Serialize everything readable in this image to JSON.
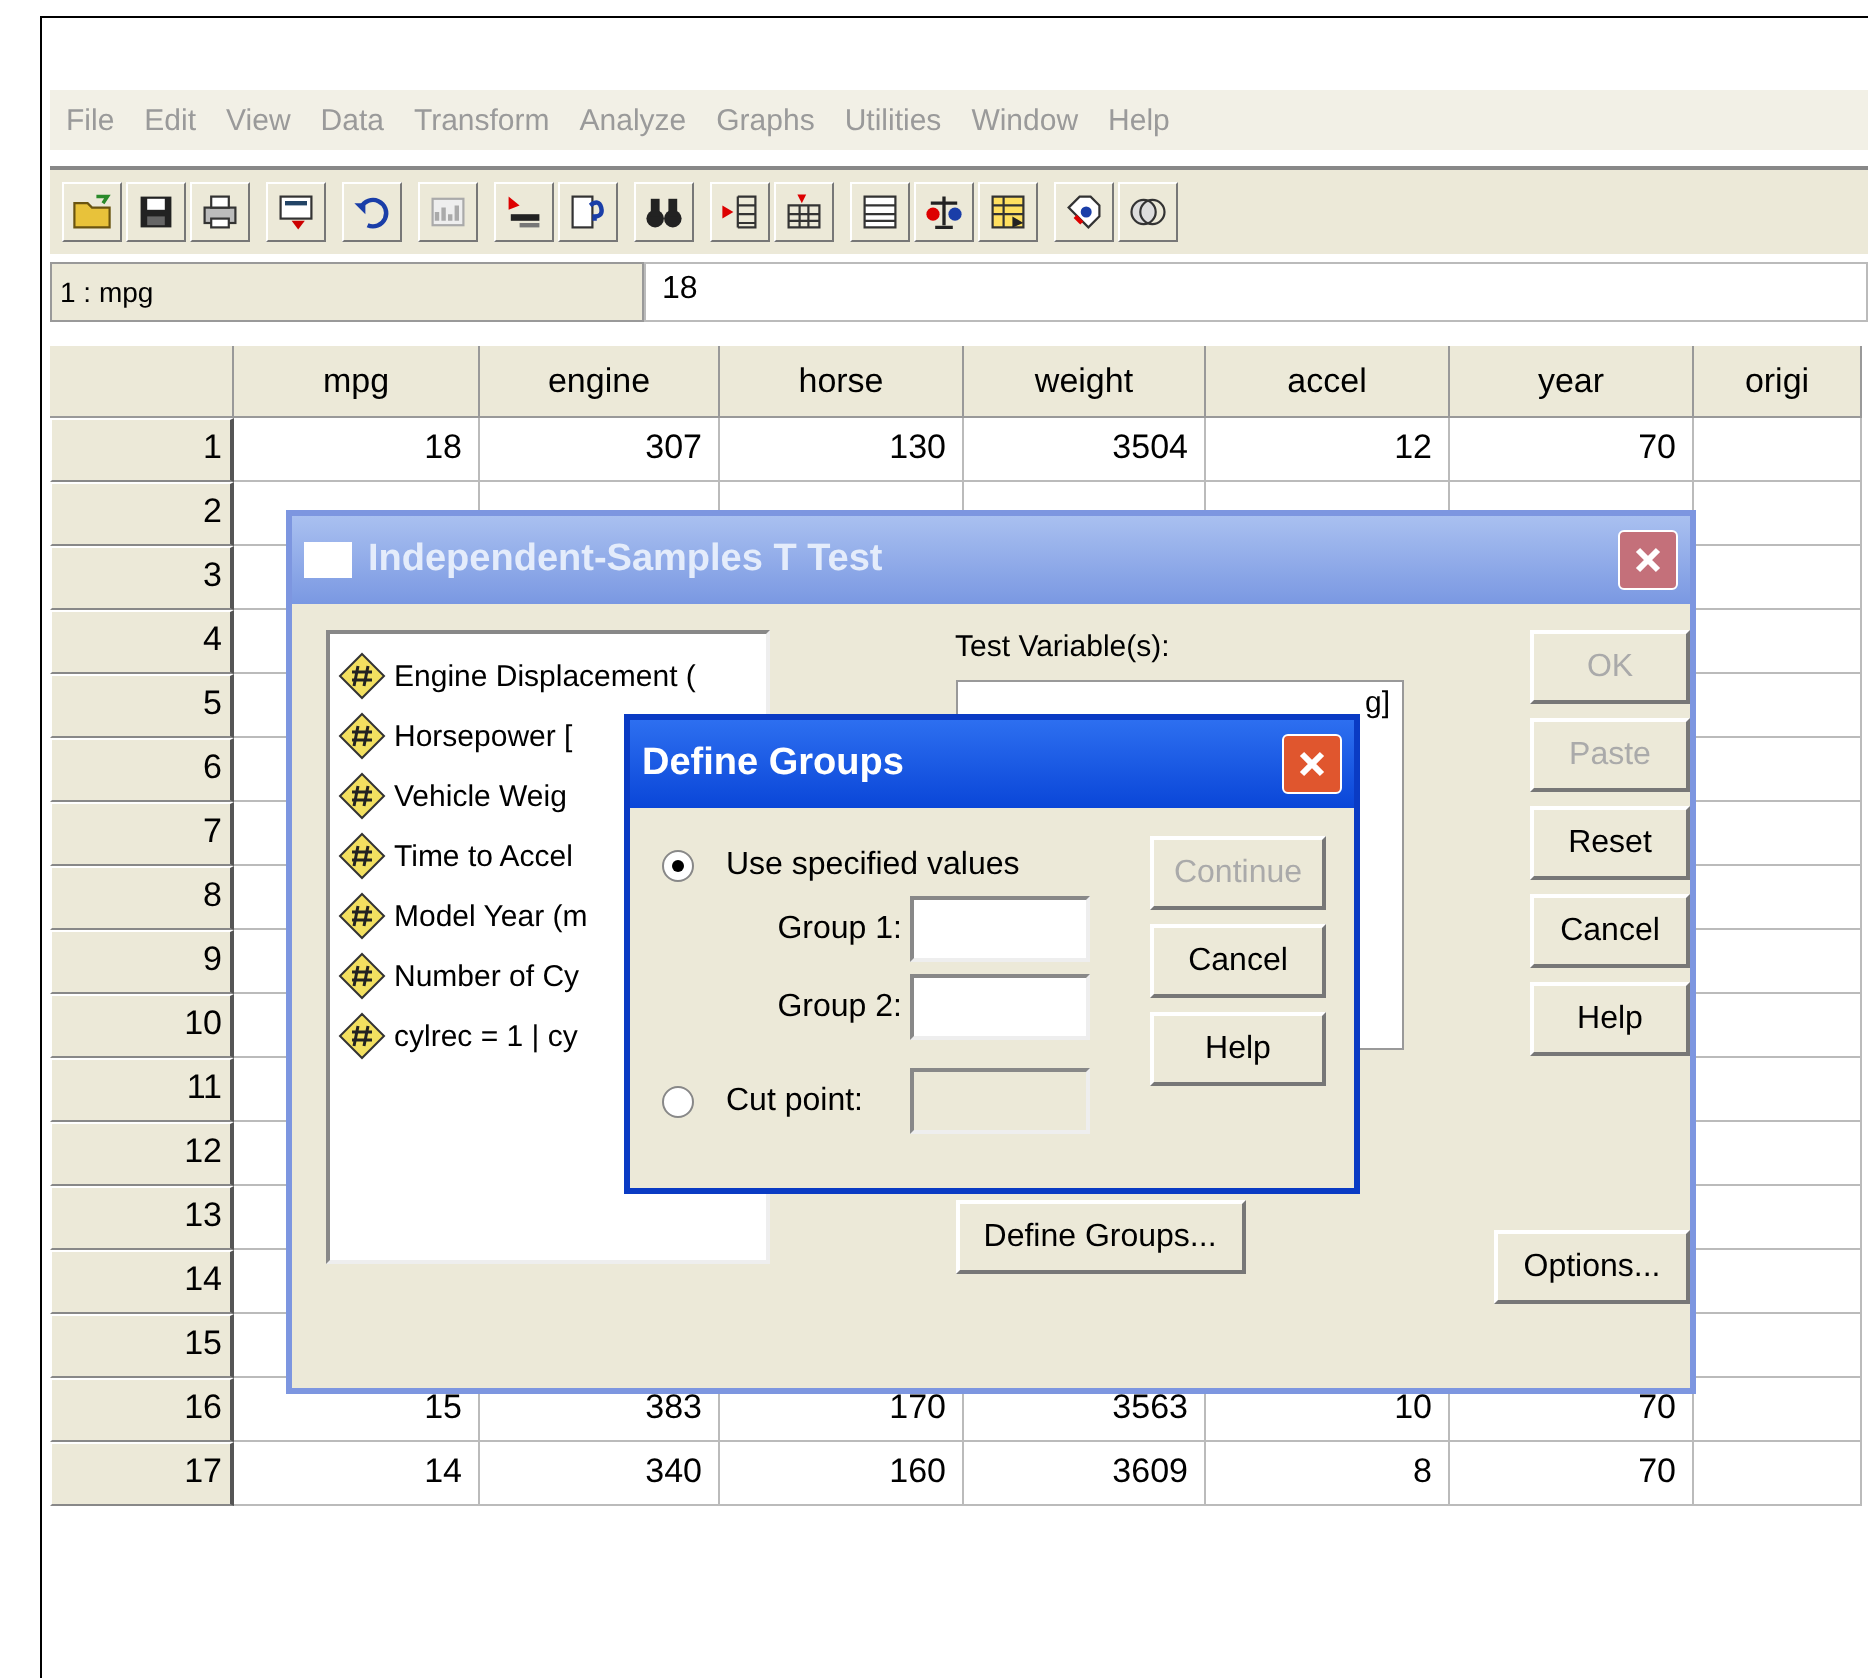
{
  "menu": [
    {
      "label": "File",
      "disabled": true
    },
    {
      "label": "Edit",
      "disabled": true
    },
    {
      "label": "View",
      "disabled": true
    },
    {
      "label": "Data",
      "disabled": true
    },
    {
      "label": "Transform",
      "disabled": true
    },
    {
      "label": "Analyze",
      "disabled": true
    },
    {
      "label": "Graphs",
      "disabled": true
    },
    {
      "label": "Utilities",
      "disabled": true
    },
    {
      "label": "Window",
      "disabled": true
    },
    {
      "label": "Help",
      "disabled": true
    }
  ],
  "cell_editor": {
    "cell": "1 : mpg",
    "value": "18"
  },
  "grid": {
    "columns": [
      "mpg",
      "engine",
      "horse",
      "weight",
      "accel",
      "year",
      "origi"
    ],
    "rows": [
      {
        "number": "1",
        "cells": [
          "18",
          "307",
          "130",
          "3504",
          "12",
          "70"
        ]
      },
      {
        "number": "2"
      },
      {
        "number": "3"
      },
      {
        "number": "4"
      },
      {
        "number": "5"
      },
      {
        "number": "6"
      },
      {
        "number": "7"
      },
      {
        "number": "8"
      },
      {
        "number": "9"
      },
      {
        "number": "10"
      },
      {
        "number": "11"
      },
      {
        "number": "12"
      },
      {
        "number": "13"
      },
      {
        "number": "14"
      },
      {
        "number": "15"
      },
      {
        "number": "16",
        "cells": [
          "15",
          "383",
          "170",
          "3563",
          "10",
          "70"
        ]
      },
      {
        "number": "17",
        "cells": [
          "14",
          "340",
          "160",
          "3609",
          "8",
          "70"
        ]
      }
    ]
  },
  "t_test_dialog": {
    "title": "Independent-Samples T Test",
    "variables": [
      "Engine Displacement (",
      "Horsepower [",
      "Vehicle Weig",
      "Time to Accel",
      "Model Year (m",
      "Number of Cy",
      "cylrec = 1 | cy"
    ],
    "test_variables_label": "Test Variable(s):",
    "test_variables": [
      "g]"
    ],
    "buttons": [
      {
        "label": "OK",
        "disabled": true
      },
      {
        "label": "Paste",
        "disabled": true
      },
      {
        "label": "Reset",
        "disabled": false
      },
      {
        "label": "Cancel",
        "disabled": false
      },
      {
        "label": "Help",
        "disabled": false
      }
    ],
    "define_groups_button": "Define Groups...",
    "options_button": "Options..."
  },
  "define_groups_dialog": {
    "title": "Define Groups",
    "use_values": {
      "label": "Use specified values",
      "selected": true
    },
    "group_fields": [
      {
        "label": "Group 1:"
      },
      {
        "label": "Group 2:"
      }
    ],
    "cut_point": {
      "label": "Cut point:",
      "selected": false,
      "field_disabled": true
    },
    "buttons": [
      {
        "label": "Continue",
        "disabled": true
      },
      {
        "label": "Cancel",
        "disabled": false
      },
      {
        "label": "Help",
        "disabled": false
      }
    ]
  }
}
